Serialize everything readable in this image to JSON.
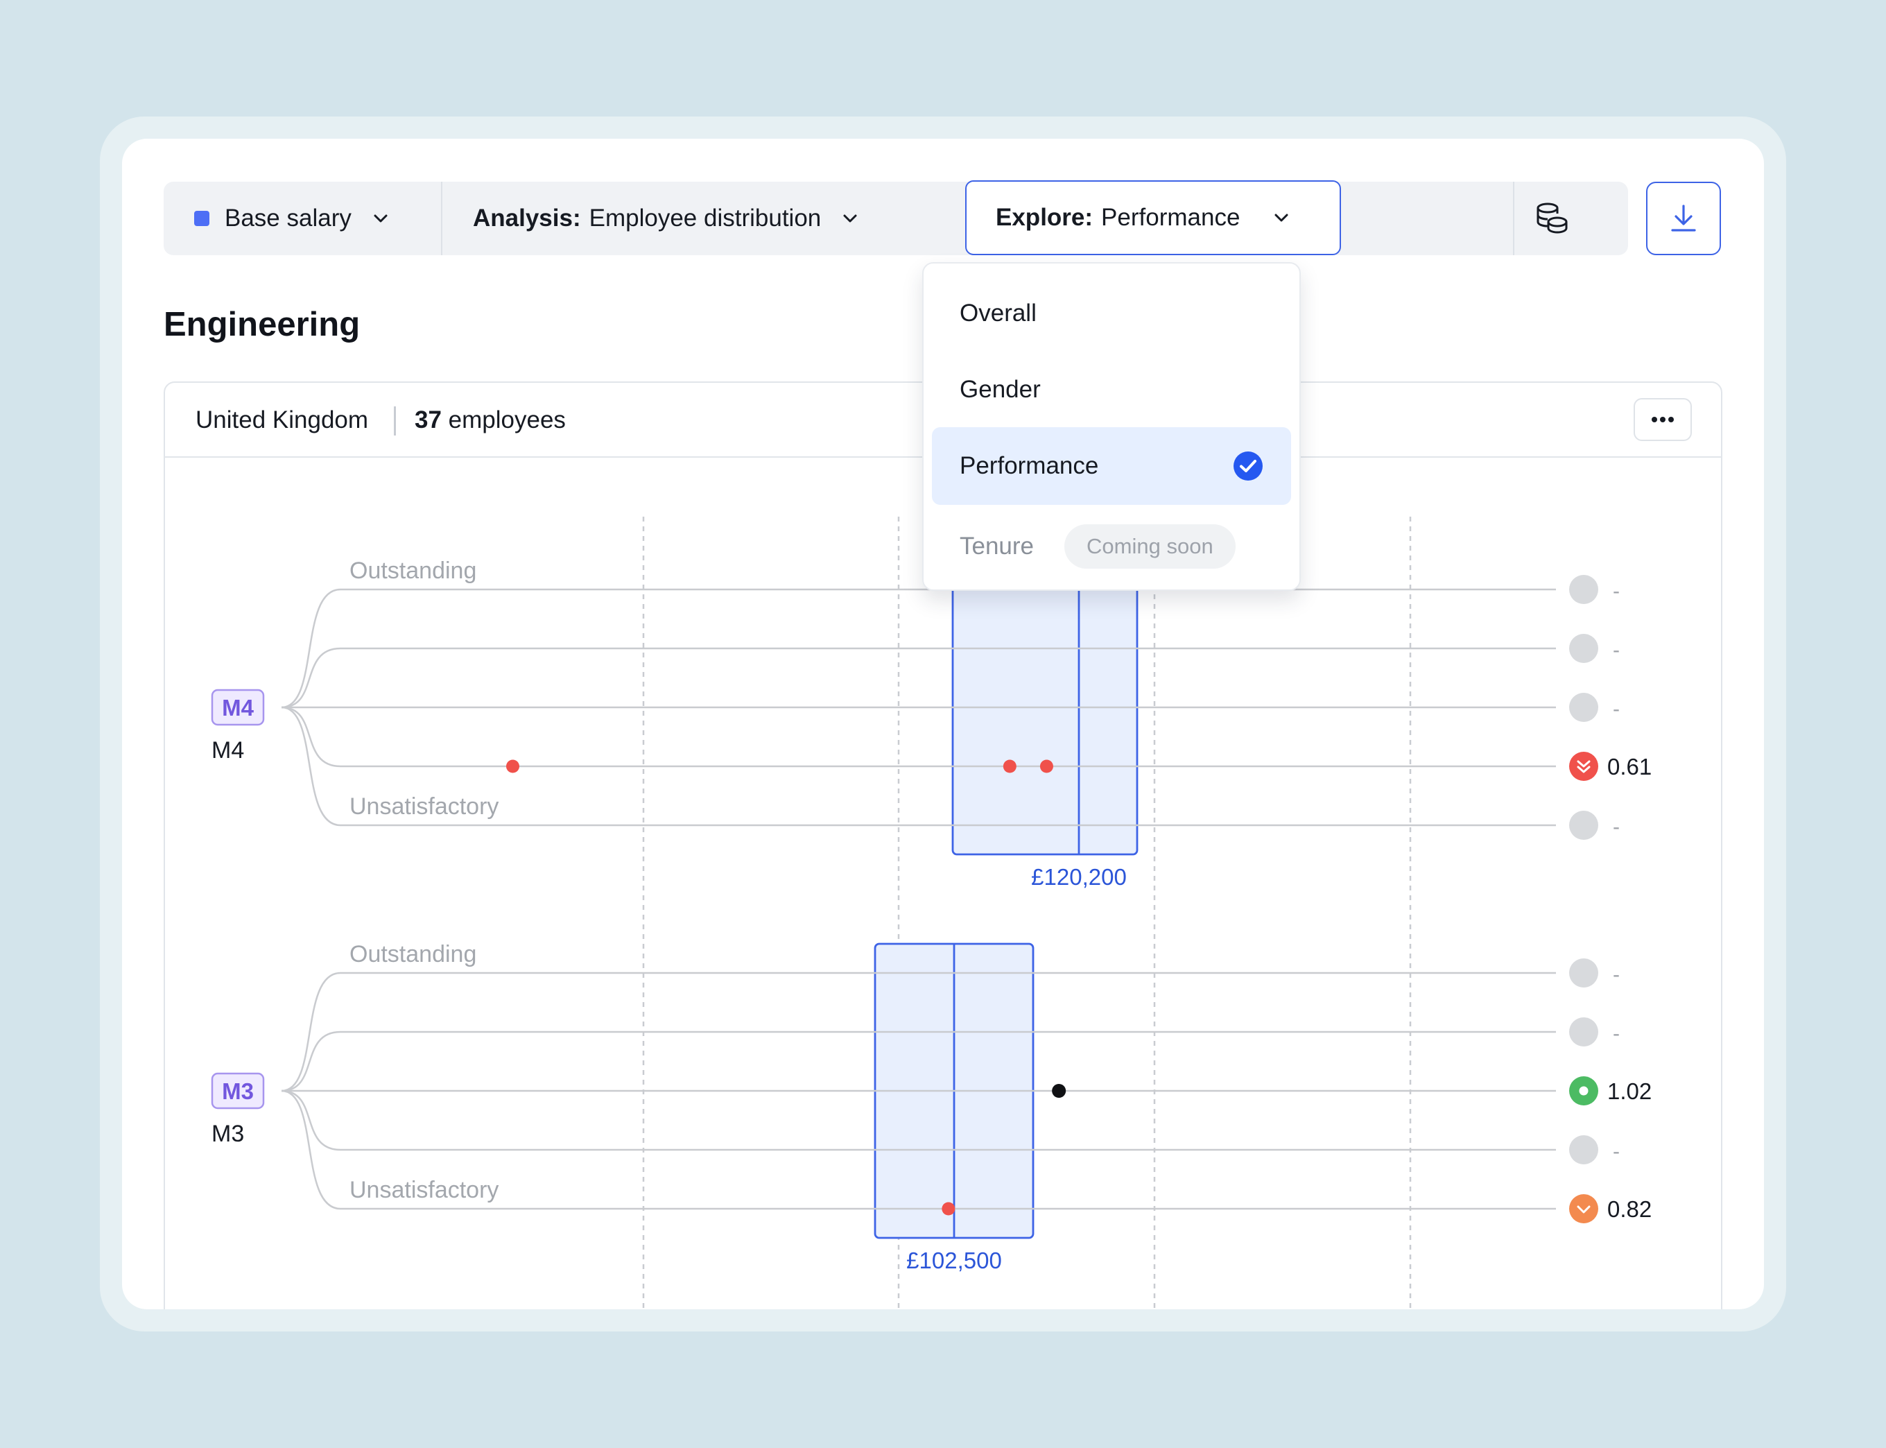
{
  "toolbar": {
    "metric_label": "Base salary",
    "metric_color": "#4d6ef5",
    "analysis_prefix": "Analysis:",
    "analysis_value": "Employee distribution",
    "explore_prefix": "Explore:",
    "explore_value": "Performance",
    "data_icon": "coins-stack-icon",
    "download_icon": "download-icon"
  },
  "page": {
    "title": "Engineering"
  },
  "card": {
    "country": "United Kingdom",
    "employee_count": "37",
    "employee_suffix": "employees",
    "more_icon": "more-horizontal-icon"
  },
  "dropdown": {
    "items": [
      {
        "label": "Overall",
        "selected": false,
        "disabled": false
      },
      {
        "label": "Gender",
        "selected": false,
        "disabled": false
      },
      {
        "label": "Performance",
        "selected": true,
        "disabled": false
      },
      {
        "label": "Tenure",
        "selected": false,
        "disabled": true,
        "badge": "Coming soon"
      }
    ]
  },
  "colors": {
    "accent": "#3d63e6",
    "red": "#f0514b",
    "green": "#4cbb63",
    "orange": "#f38a4f",
    "neutral": "#d8dadd"
  },
  "chart_data": {
    "type": "scatter",
    "top_label": "Outstanding",
    "bottom_label": "Unsatisfactory",
    "levels": [
      {
        "badge": "M4",
        "name": "M4",
        "box_label": "£120,200",
        "rows": [
          {
            "points": [],
            "status": "neutral",
            "value": "-"
          },
          {
            "points": [],
            "status": "neutral",
            "value": "-"
          },
          {
            "points": [],
            "status": "neutral",
            "value": "-"
          },
          {
            "points": [
              0.15,
              0.555,
              0.585
            ],
            "point_color": "red",
            "status": "red",
            "value": "0.61"
          },
          {
            "points": [],
            "status": "neutral",
            "value": "-"
          }
        ]
      },
      {
        "badge": "M3",
        "name": "M3",
        "box_label": "£102,500",
        "rows": [
          {
            "points": [],
            "status": "neutral",
            "value": "-"
          },
          {
            "points": [],
            "status": "neutral",
            "value": "-"
          },
          {
            "points": [
              0.595
            ],
            "point_color": "black",
            "status": "green",
            "value": "1.02"
          },
          {
            "points": [],
            "status": "neutral",
            "value": "-"
          },
          {
            "points": [
              0.505
            ],
            "point_color": "red",
            "status": "orange",
            "value": "0.82"
          }
        ]
      }
    ]
  }
}
